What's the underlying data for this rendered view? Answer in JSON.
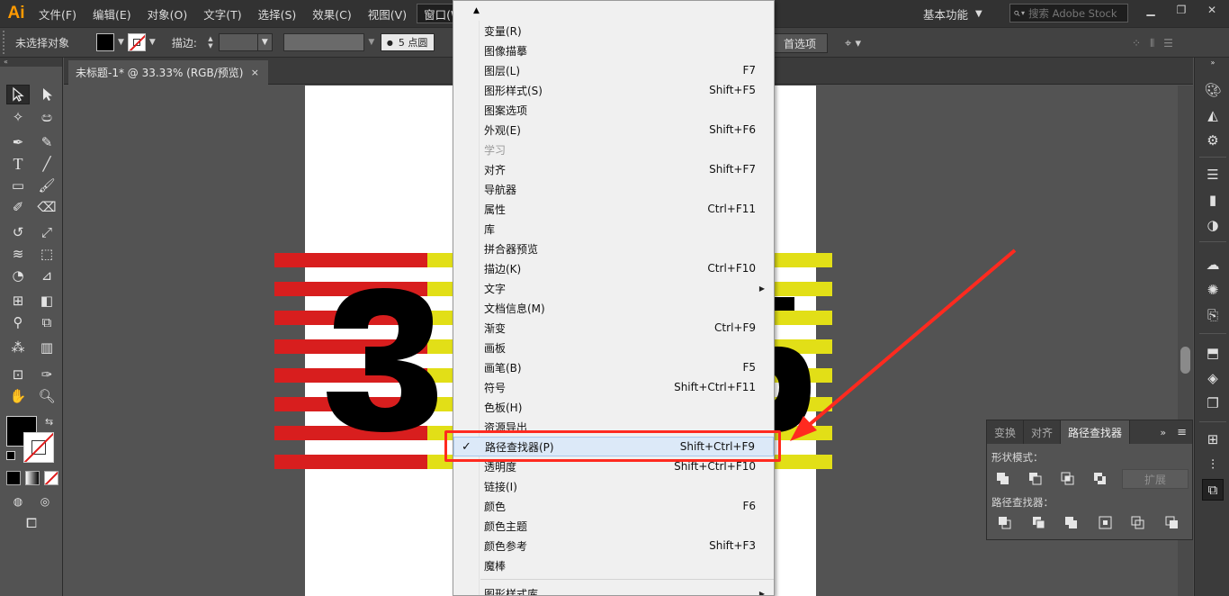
{
  "app": {
    "logo": "Ai",
    "menus": [
      "文件(F)",
      "编辑(E)",
      "对象(O)",
      "文字(T)",
      "选择(S)",
      "效果(C)",
      "视图(V)",
      "窗口(W)"
    ],
    "active_menu_index": 7,
    "workspace": "基本功能",
    "search_placeholder": "搜索 Adobe Stock",
    "accent": "#ff9a00"
  },
  "control_bar": {
    "selection_status": "未选择对象",
    "stroke_label": "描边:",
    "brush_size": "5 点圆",
    "preferences_button": "首选项"
  },
  "document": {
    "tab_title": "未标题-1* @ 33.33% (RGB/预览)",
    "tab_close": "×"
  },
  "window_menu": {
    "items": [
      {
        "label": "变量(R)",
        "shortcut": ""
      },
      {
        "label": "图像描摹",
        "shortcut": ""
      },
      {
        "label": "图层(L)",
        "shortcut": "F7"
      },
      {
        "label": "图形样式(S)",
        "shortcut": "Shift+F5"
      },
      {
        "label": "图案选项",
        "shortcut": ""
      },
      {
        "label": "外观(E)",
        "shortcut": "Shift+F6"
      },
      {
        "label": "学习",
        "shortcut": "",
        "disabled": true
      },
      {
        "label": "对齐",
        "shortcut": "Shift+F7"
      },
      {
        "label": "导航器",
        "shortcut": ""
      },
      {
        "label": "属性",
        "shortcut": "Ctrl+F11"
      },
      {
        "label": "库",
        "shortcut": ""
      },
      {
        "label": "拼合器预览",
        "shortcut": ""
      },
      {
        "label": "描边(K)",
        "shortcut": "Ctrl+F10"
      },
      {
        "label": "文字",
        "shortcut": "",
        "submenu": true
      },
      {
        "label": "文档信息(M)",
        "shortcut": ""
      },
      {
        "label": "渐变",
        "shortcut": "Ctrl+F9"
      },
      {
        "label": "画板",
        "shortcut": ""
      },
      {
        "label": "画笔(B)",
        "shortcut": "F5"
      },
      {
        "label": "符号",
        "shortcut": "Shift+Ctrl+F11"
      },
      {
        "label": "色板(H)",
        "shortcut": ""
      },
      {
        "label": "资源导出",
        "shortcut": ""
      },
      {
        "label": "路径查找器(P)",
        "shortcut": "Shift+Ctrl+F9",
        "checked": true,
        "highlighted": true
      },
      {
        "label": "透明度",
        "shortcut": "Shift+Ctrl+F10"
      },
      {
        "label": "链接(I)",
        "shortcut": ""
      },
      {
        "label": "颜色",
        "shortcut": "F6"
      },
      {
        "label": "颜色主题",
        "shortcut": ""
      },
      {
        "label": "颜色参考",
        "shortcut": "Shift+F3"
      },
      {
        "label": "魔棒",
        "shortcut": ""
      }
    ],
    "after_divider": [
      {
        "label": "图形样式库",
        "shortcut": "",
        "submenu": true
      }
    ],
    "checkmark": "✓"
  },
  "pathfinder_panel": {
    "tabs": [
      "变换",
      "对齐",
      "路径查找器"
    ],
    "active_tab_index": 2,
    "shape_modes_label": "形状模式：",
    "pathfinders_label": "路径查找器：",
    "expand_button": "扩展"
  },
  "artwork": {
    "red": "#d81e1e",
    "yellow": "#e2df17",
    "black": "#000000",
    "stripe_count": 8
  },
  "annotation": {
    "color": "#ff2a1f"
  }
}
